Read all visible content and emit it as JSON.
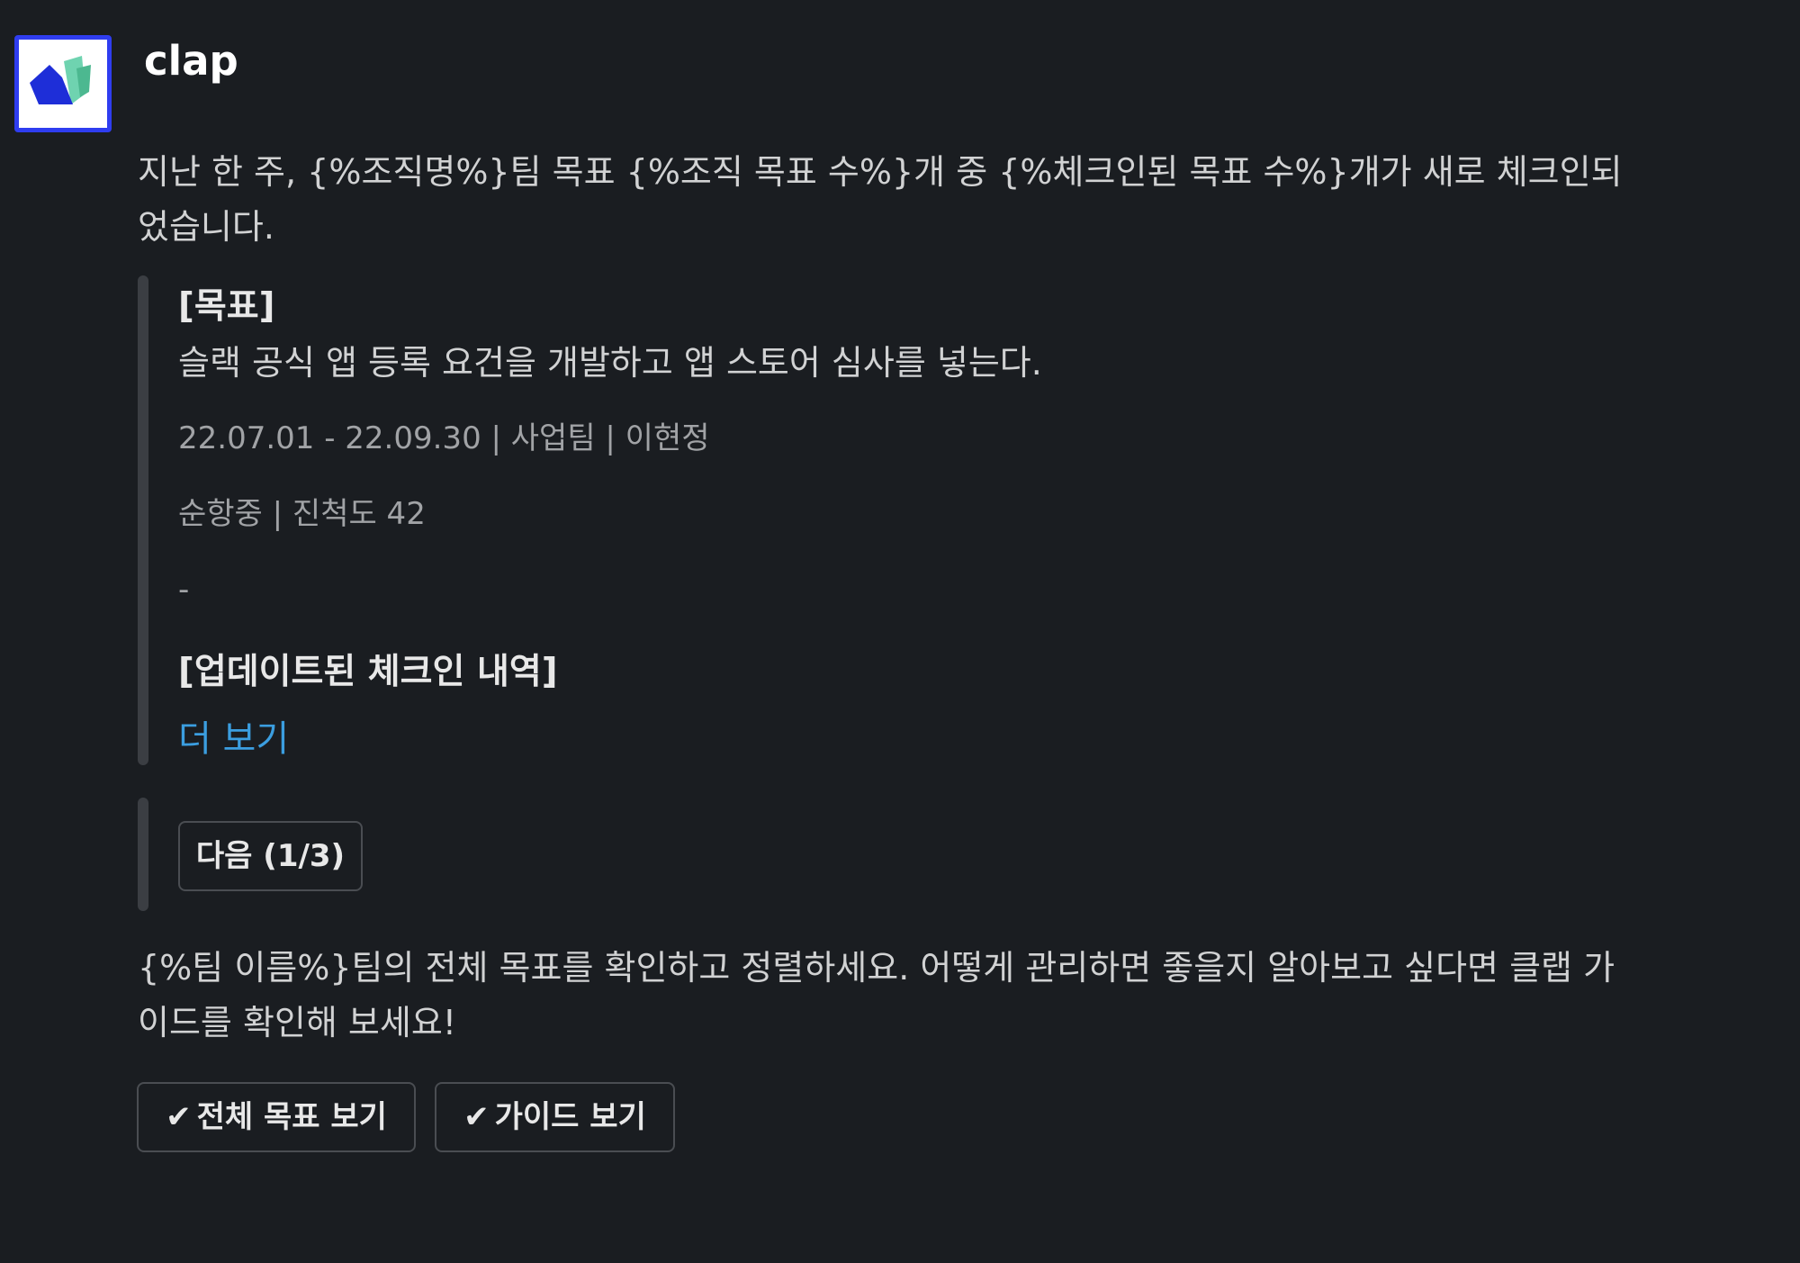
{
  "sender": {
    "name": "clap"
  },
  "message": {
    "intro": "지난 한 주, {%조직명%}팀 목표 {%조직 목표 수%}개 중 {%체크인된 목표 수%}개가 새로 체크인되었습니다.",
    "outro": "{%팀 이름%}팀의 전체 목표를 확인하고 정렬하세요. 어떻게 관리하면 좋을지 알아보고 싶다면 클랩 가이드를 확인해 보세요!"
  },
  "quote": {
    "goal_title": "[목표]",
    "goal_text": "슬랙 공식 앱 등록 요건을 개발하고 앱 스토어 심사를 넣는다.",
    "meta_line1": "22.07.01 - 22.09.30 | 사업팀 | 이현정",
    "meta_line2": "순항중 | 진척도 42",
    "dash": "-",
    "update_title": "[업데이트된 체크인 내역]",
    "more_link": "더 보기"
  },
  "buttons": {
    "next": "다음 (1/3)",
    "view_all_goals": "전체 목표 보기",
    "view_guide": "가이드 보기"
  },
  "icons": {
    "check": "check-icon",
    "logo": "clap-logo-icon"
  },
  "colors": {
    "background": "#1a1d21",
    "link": "#3b9ee0",
    "avatar_border": "#2f3df0",
    "logo_blue": "#1e2ed8",
    "logo_green": "#5cc6a0"
  }
}
